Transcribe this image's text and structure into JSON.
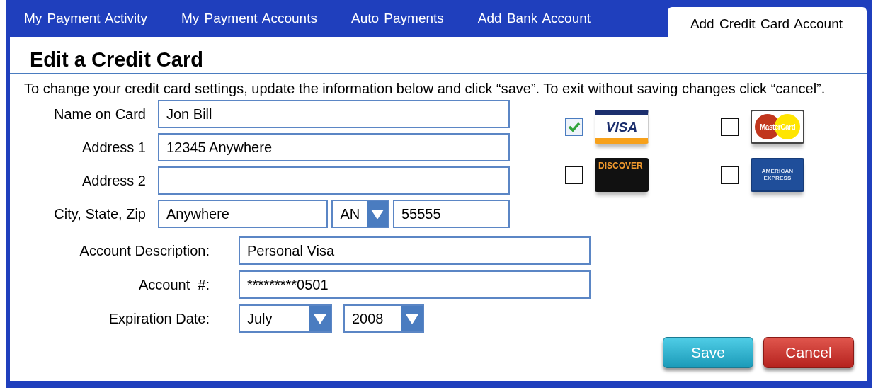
{
  "tabs": [
    {
      "label": "My Payment Activity",
      "selected": false
    },
    {
      "label": "My Payment Accounts",
      "selected": false
    },
    {
      "label": "Auto Payments",
      "selected": false
    },
    {
      "label": "Add  Bank Account",
      "selected": false
    },
    {
      "label": "Add Credit Card Account",
      "selected": true
    }
  ],
  "heading": "Edit a Credit Card",
  "instructions": "To change your credit card settings, update the information below and click “save”.  To exit without saving changes click “cancel”.",
  "address_fields": [
    {
      "label": "Name on Card",
      "value": "Jon Bill"
    },
    {
      "label": "Address 1",
      "value": "12345 Anywhere"
    },
    {
      "label": "Address 2"
    }
  ],
  "city_state_zip": {
    "label": "City, State, Zip",
    "city": "Anywhere",
    "state": "AN",
    "zip": "55555"
  },
  "card_types": [
    {
      "kind": "visa",
      "logo_lines": [
        "VISA"
      ],
      "checked": true
    },
    {
      "kind": "mastercard",
      "logo_lines": [
        "MasterCard"
      ],
      "checked": false
    },
    {
      "kind": "discover",
      "logo_lines": [
        "DISCOVER"
      ],
      "checked": false
    },
    {
      "kind": "amex",
      "logo_lines": [
        "AMERICAN",
        "EXPRESS"
      ],
      "checked": false
    }
  ],
  "account": {
    "description_label": "Account Description:",
    "description": "Personal Visa",
    "number_label": "Account  #:",
    "number": "*********0501",
    "expiration_label": "Expiration Date:",
    "month": "July",
    "year": "2008"
  },
  "buttons": [
    {
      "kind": "save",
      "label": "Save"
    },
    {
      "kind": "cancel",
      "label": "Cancel"
    }
  ]
}
